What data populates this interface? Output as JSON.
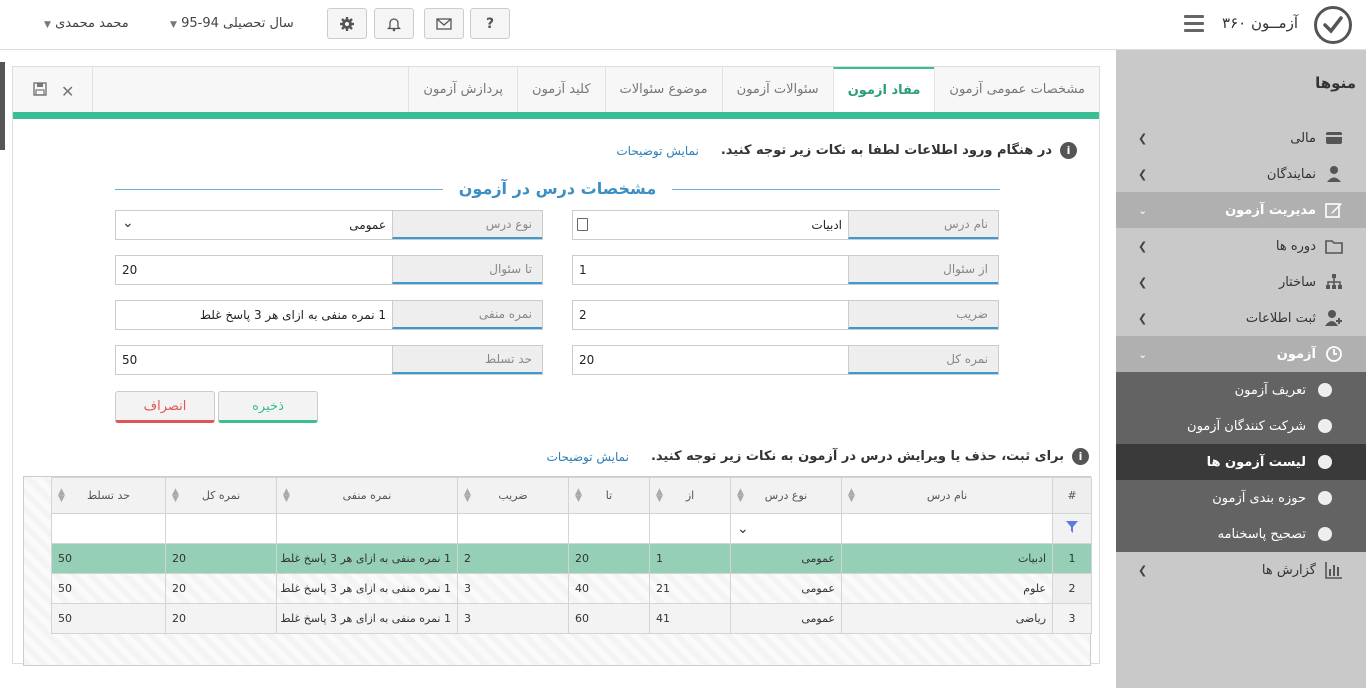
{
  "header": {
    "app_title": "آزمــون ۳۶۰",
    "year_label": "سال تحصیلی 94-95",
    "user_name": "محمد محمدی",
    "help_label": "?"
  },
  "sidebar": {
    "title": "منوها",
    "items": [
      {
        "label": "مالی",
        "icon": "card-icon"
      },
      {
        "label": "نمایندگان",
        "icon": "agent-icon"
      },
      {
        "label": "مدیریت آزمون",
        "icon": "edit-icon"
      },
      {
        "label": "دوره ها",
        "icon": "folder-icon"
      },
      {
        "label": "ساختار",
        "icon": "sitemap-icon"
      },
      {
        "label": "ثبت اطلاعات",
        "icon": "user-add-icon"
      },
      {
        "label": "آزمون",
        "icon": "clock-icon"
      },
      {
        "label": "گزارش ها",
        "icon": "bar-chart-icon"
      }
    ],
    "sub_items": [
      "تعریف آزمون",
      "شرکت کنندگان آزمون",
      "لیست آزمون ها",
      "حوزه بندی آزمون",
      "تصحیح پاسخنامه"
    ]
  },
  "tabs": [
    "مشخصات عمومی آزمون",
    "مفاد ازمون",
    "سئوالات آزمون",
    "موضوع سئوالات",
    "کلید آزمون",
    "پردازش آزمون"
  ],
  "notice1": {
    "text": "در هنگام ورود اطلاعات لطفا به نکات زیر توجه کنید.",
    "link": "نمایش توضیحات"
  },
  "section_title": "مشخصات درس در آزمون",
  "form": {
    "lesson_name": {
      "label": "نام درس",
      "value": "ادبیات"
    },
    "lesson_type": {
      "label": "نوع درس",
      "value": "عمومی"
    },
    "from_q": {
      "label": "از سئوال",
      "value": "1"
    },
    "to_q": {
      "label": "تا سئوال",
      "value": "20"
    },
    "coef": {
      "label": "ضریب",
      "value": "2"
    },
    "negative": {
      "label": "نمره منفی",
      "value": "1 نمره منفی به ازای هر 3 پاسخ غلط"
    },
    "total": {
      "label": "نمره کل",
      "value": "20"
    },
    "mastery": {
      "label": "حد تسلط",
      "value": "50"
    }
  },
  "buttons": {
    "save": "ذخیره",
    "cancel": "انصراف"
  },
  "notice2": {
    "text": "برای ثبت، حذف یا ویرایش درس در آزمون به نکات زیر توجه کنید.",
    "link": "نمایش توضیحات"
  },
  "table": {
    "columns": [
      "#",
      "نام درس",
      "نوع درس",
      "از",
      "تا",
      "ضریب",
      "نمره منفی",
      "نمره کل",
      "حد تسلط"
    ],
    "rows": [
      [
        "1",
        "ادبیات",
        "عمومی",
        "1",
        "20",
        "2",
        "1 نمره منفی به ازای هر 3 پاسخ غلط",
        "20",
        "50"
      ],
      [
        "2",
        "علوم",
        "عمومی",
        "21",
        "40",
        "3",
        "1 نمره منفی به ازای هر 3 پاسخ غلط",
        "20",
        "50"
      ],
      [
        "3",
        "ریاضی",
        "عمومی",
        "41",
        "60",
        "3",
        "1 نمره منفی به ازای هر 3 پاسخ غلط",
        "20",
        "50"
      ]
    ]
  }
}
